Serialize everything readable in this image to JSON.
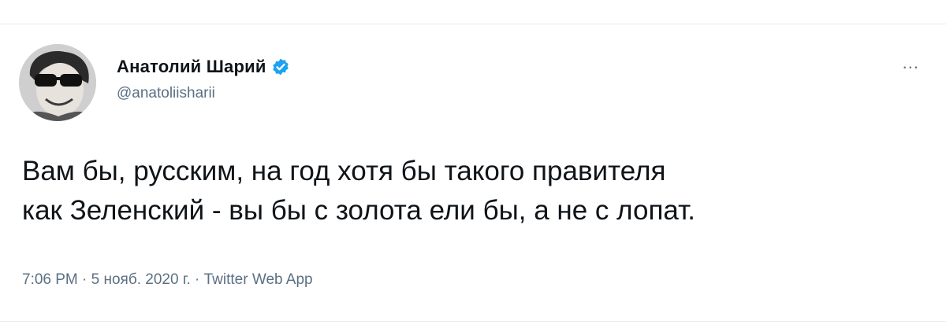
{
  "tweet": {
    "author": {
      "display_name": "Анатолий Шарий",
      "handle": "@anatoliisharii",
      "verified": true,
      "verified_color": "#1da1f2"
    },
    "more_menu": "...",
    "text_lines": [
      "Вам бы, русским, на год хотя бы такого правителя",
      "как Зеленский - вы бы с золота ели бы, а не с лопат."
    ],
    "meta": {
      "time": "7:06 PM",
      "separator": "·",
      "date": "5 нояб. 2020 г.",
      "source": "Twitter Web App"
    }
  }
}
